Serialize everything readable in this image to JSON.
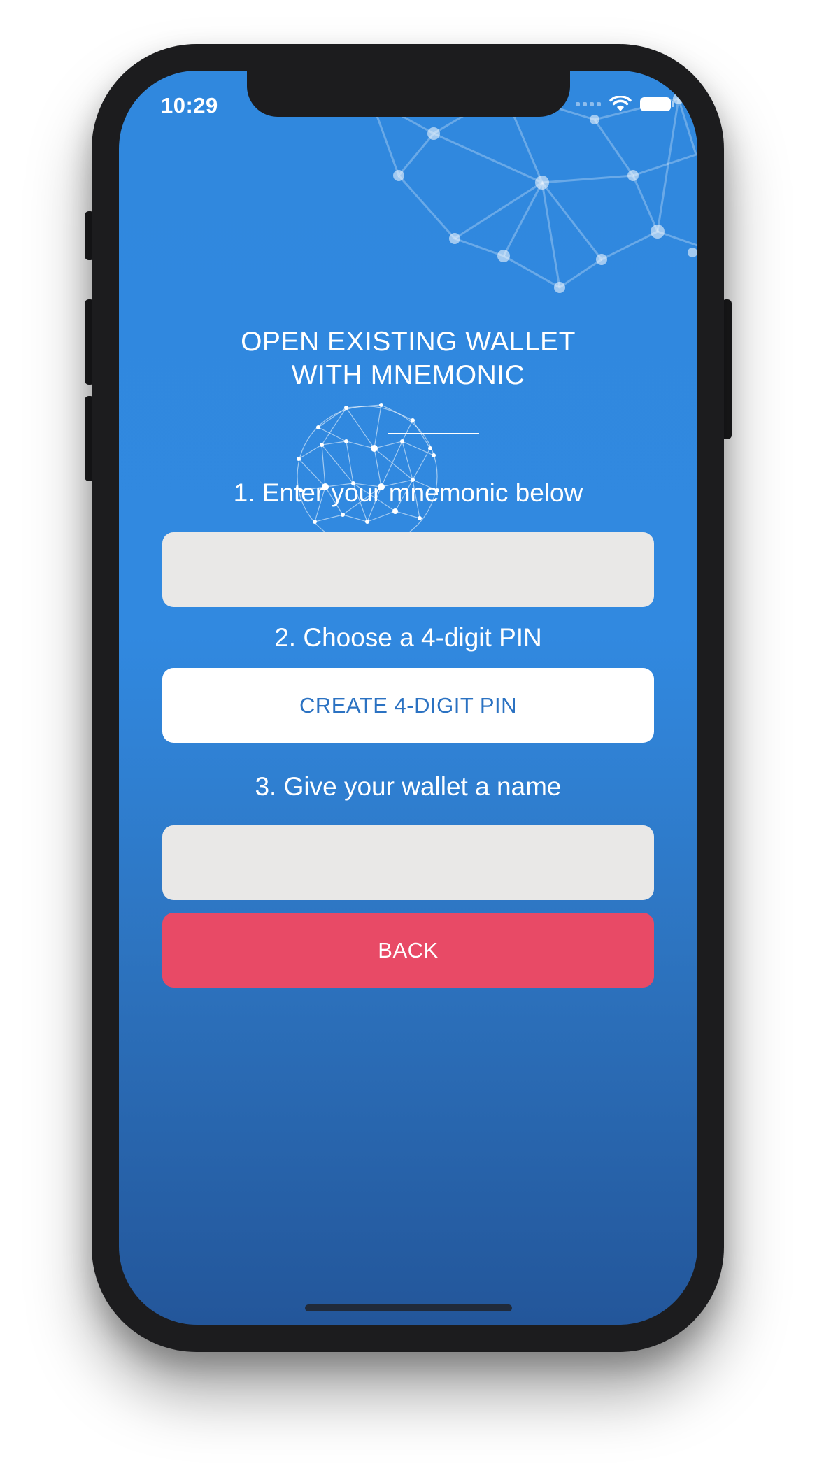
{
  "status_bar": {
    "time": "10:29"
  },
  "screen": {
    "title_line1": "OPEN EXISTING WALLET",
    "title_line2": "WITH MNEMONIC",
    "step1_label": "1. Enter your mnemonic below",
    "mnemonic_value": "",
    "step2_label": "2. Choose a 4-digit PIN",
    "create_pin_label": "CREATE 4-DIGIT PIN",
    "step3_label": "3. Give your wallet a name",
    "wallet_name_value": "",
    "back_label": "BACK"
  },
  "colors": {
    "background_top": "#3088de",
    "background_bottom": "#23569a",
    "input_background": "#e9e8e7",
    "button_white": "#ffffff",
    "button_text_blue": "#2b72c2",
    "back_button": "#e84a66"
  },
  "icons": {
    "wifi": "wifi-icon",
    "battery": "battery-icon",
    "signal": "cellular-signal-icon",
    "logo": "network-globe-icon"
  }
}
